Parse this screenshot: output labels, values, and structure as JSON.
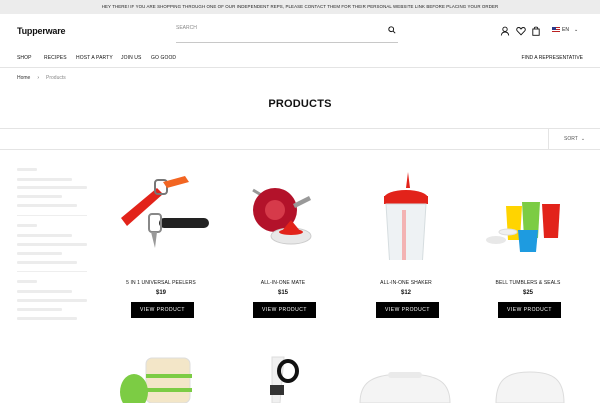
{
  "announcement": "HEY THERE! IF YOU ARE SHOPPING THROUGH ONE OF OUR INDEPENDENT REPS, PLEASE CONTACT THEM FOR THEIR PERSONAL WEBSITE LINK BEFORE PLACING YOUR ORDER",
  "header": {
    "logo": "Tupperware",
    "search_placeholder": "SEARCH",
    "icons": [
      "user-icon",
      "heart-icon",
      "bag-icon"
    ],
    "language": "EN"
  },
  "nav": {
    "items": [
      "SHOP",
      "RECIPES",
      "HOST A PARTY",
      "JOIN US",
      "GO GOOD"
    ],
    "right": "FIND A REPRESENTATIVE"
  },
  "breadcrumb": {
    "home": "Home",
    "current": "Products"
  },
  "page_title": "PRODUCTS",
  "sort_label": "SORT",
  "products": [
    {
      "name": "5 IN 1 UNIVERSAL PEELERS",
      "price": "$19",
      "button": "VIEW PRODUCT"
    },
    {
      "name": "ALL-IN-ONE MATE",
      "price": "$15",
      "button": "VIEW PRODUCT"
    },
    {
      "name": "ALL-IN-ONE SHAKER",
      "price": "$12",
      "button": "VIEW PRODUCT"
    },
    {
      "name": "BELL TUMBLERS & SEALS",
      "price": "$25",
      "button": "VIEW PRODUCT"
    }
  ],
  "colors": {
    "accent": "#000000",
    "announce_bg": "#ececec",
    "brand_red": "#e2231a"
  }
}
